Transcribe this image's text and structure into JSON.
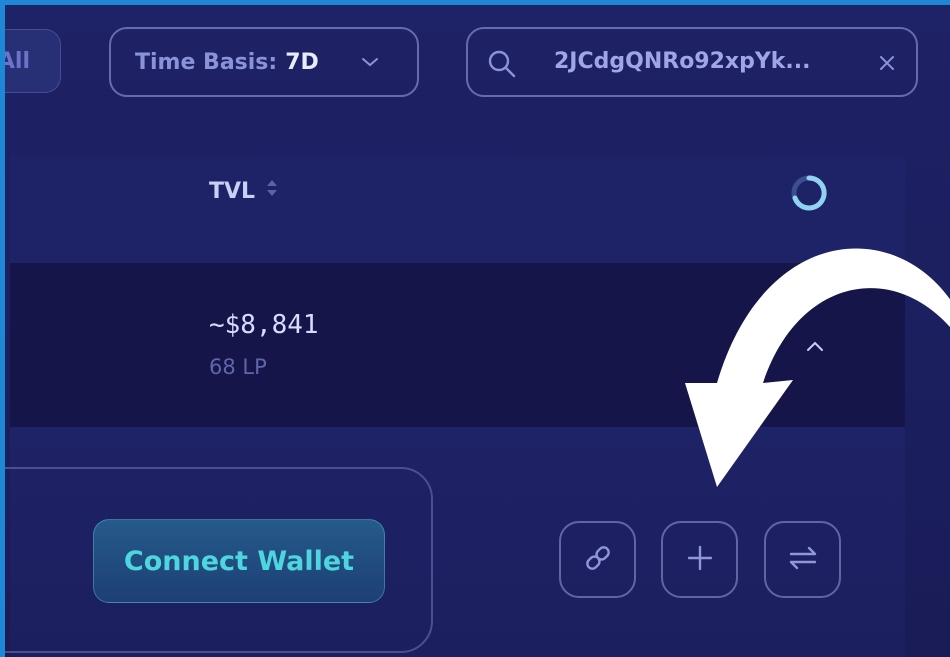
{
  "toolbar": {
    "all_label": "All",
    "time_basis_label": "Time Basis:",
    "time_basis_value": "7D",
    "search_value": "2JCdgQNRo92xpYk..."
  },
  "table": {
    "tvl_header": "TVL",
    "row": {
      "tvl_value": "~$8,841",
      "lp_count": "68 LP"
    }
  },
  "expanded": {
    "connect_wallet_label": "Connect Wallet",
    "actions": [
      "link-icon",
      "plus-icon",
      "swap-icon"
    ]
  },
  "colors": {
    "background": "#1b1f5c",
    "frame_border": "#1f88d6",
    "accent_teal": "#4dd6dd",
    "row_highlight": "#15154a"
  }
}
